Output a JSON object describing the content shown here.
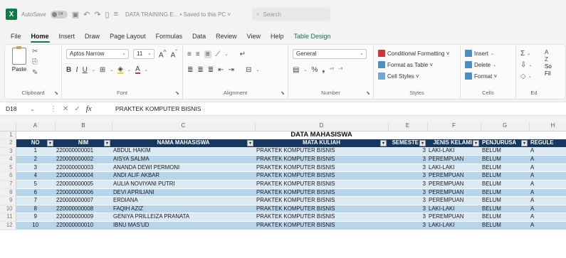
{
  "titlebar": {
    "app_logo": "X",
    "autosave_label": "AutoSave",
    "autosave_state": "Off",
    "doc_title": "DATA TRAINING E... • Saved to this PC ˅",
    "search_placeholder": "Search"
  },
  "tabs": [
    "File",
    "Home",
    "Insert",
    "Draw",
    "Page Layout",
    "Formulas",
    "Data",
    "Review",
    "View",
    "Help",
    "Table Design"
  ],
  "ribbon": {
    "clipboard": {
      "paste": "Paste",
      "label": "Clipboard"
    },
    "font": {
      "name": "Aptos Narrow",
      "size": "11",
      "label": "Font"
    },
    "alignment": {
      "label": "Alignment"
    },
    "number": {
      "format": "General",
      "label": "Number"
    },
    "styles": {
      "conditional": "Conditional Formatting ˅",
      "format_table": "Format as Table ˅",
      "cell_styles": "Cell Styles ˅",
      "label": "Styles"
    },
    "cells": {
      "insert": "Insert",
      "delete": "Delete",
      "format": "Format ˅",
      "label": "Cells"
    },
    "editing": {
      "label": "Ed",
      "sort": "So",
      "find": "Fil"
    }
  },
  "formula_bar": {
    "name_box": "D18",
    "content": "PRAKTEK KOMPUTER BISNIS"
  },
  "sheet": {
    "columns": [
      "A",
      "B",
      "C",
      "D",
      "E",
      "F",
      "G",
      "H"
    ],
    "title": "DATA MAHASISWA",
    "headers": [
      "NO",
      "NIM",
      "NAMA MAHASISWA",
      "MATA KULIAH",
      "SEMESTE",
      "JENIS KELAMI",
      "PENJURUSA",
      "REGULE"
    ],
    "rows": [
      [
        "1",
        "220000000001",
        "ABDUL HAKIM",
        "PRAKTEK KOMPUTER BISNIS",
        "3",
        "LAKI-LAKI",
        "BELUM",
        "A"
      ],
      [
        "2",
        "220000000002",
        "AISYA SALMA",
        "PRAKTEK KOMPUTER BISNIS",
        "3",
        "PEREMPUAN",
        "BELUM",
        "A"
      ],
      [
        "3",
        "220000000003",
        "ANANDA DEWI PERMONI",
        "PRAKTEK KOMPUTER BISNIS",
        "3",
        "LAKI-LAKI",
        "BELUM",
        "A"
      ],
      [
        "4",
        "220000000004",
        "ANDI ALIF AKBAR",
        "PRAKTEK KOMPUTER BISNIS",
        "3",
        "PEREMPUAN",
        "BELUM",
        "A"
      ],
      [
        "5",
        "220000000005",
        "AULIA NOVIYANI PUTRI",
        "PRAKTEK KOMPUTER BISNIS",
        "3",
        "PEREMPUAN",
        "BELUM",
        "A"
      ],
      [
        "6",
        "220000000006",
        "DEVI APRILIANI",
        "PRAKTEK KOMPUTER BISNIS",
        "3",
        "PEREMPUAN",
        "BELUM",
        "A"
      ],
      [
        "7",
        "220000000007",
        "ERDIANA",
        "PRAKTEK KOMPUTER BISNIS",
        "3",
        "PEREMPUAN",
        "BELUM",
        "A"
      ],
      [
        "8",
        "220000000008",
        "FAQIH AZIZ",
        "PRAKTEK KOMPUTER BISNIS",
        "3",
        "LAKI-LAKI",
        "BELUM",
        "A"
      ],
      [
        "9",
        "220000000009",
        "GENIYA PRILLEIZA PRANATA",
        "PRAKTEK KOMPUTER BISNIS",
        "3",
        "PEREMPUAN",
        "BELUM",
        "A"
      ],
      [
        "10",
        "220000000010",
        "IBNU MAS'UD",
        "PRAKTEK KOMPUTER BISNIS",
        "3",
        "LAKI-LAKI",
        "BELUM",
        "A"
      ]
    ]
  },
  "colors": {
    "accent": "#107c41",
    "table_header": "#17375e",
    "band_light": "#dbe9f5",
    "band_dark": "#b8d5ec"
  }
}
